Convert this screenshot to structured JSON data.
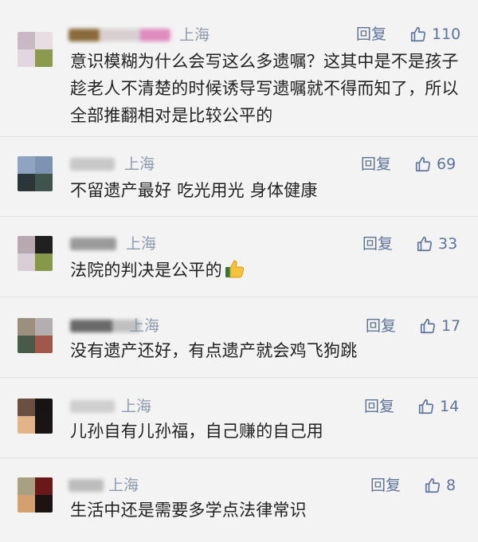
{
  "colors": {
    "background": "#f3f3f3",
    "link": "#5e7399",
    "meta": "#8e9aad",
    "text": "#222222"
  },
  "comments": [
    {
      "location": "上海",
      "reply_label": "回复",
      "likes": "110",
      "text": "意识模糊为什么会写这么多遗嘱？这其中是不是孩子趁老人不清楚的时候诱导写遗嘱就不得而知了，所以全部推翻相对是比较公平的"
    },
    {
      "location": "上海",
      "reply_label": "回复",
      "likes": "69",
      "text": "不留遗产最好 吃光用光 身体健康"
    },
    {
      "location": "上海",
      "reply_label": "回复",
      "likes": "33",
      "text": "法院的判决是公平的",
      "emoji": "thumbs-up-emoji"
    },
    {
      "location": "上海",
      "reply_label": "回复",
      "likes": "17",
      "text": "没有遗产还好，有点遗产就会鸡飞狗跳"
    },
    {
      "location": "上海",
      "reply_label": "回复",
      "likes": "14",
      "text": "儿孙自有儿孙福，自己赚的自己用"
    },
    {
      "location": "上海",
      "reply_label": "回复",
      "likes": "8",
      "text": "生活中还是需要多学点法律常识"
    }
  ]
}
